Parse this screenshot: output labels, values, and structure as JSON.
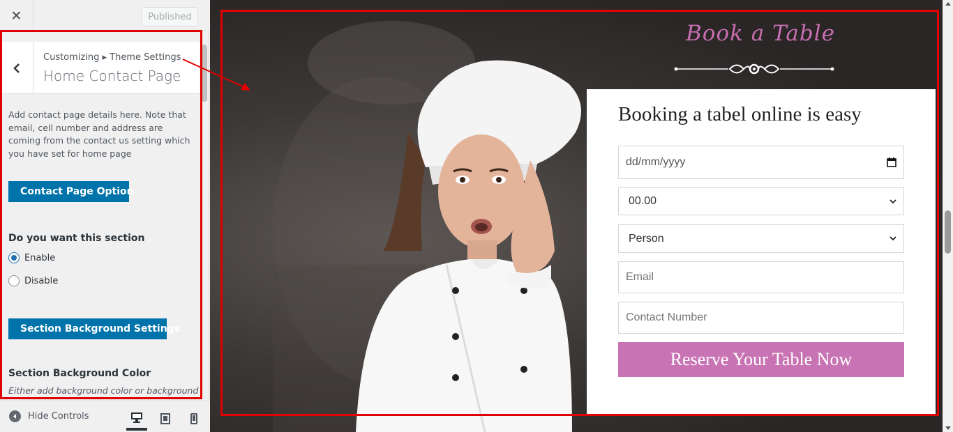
{
  "topbar": {
    "close_icon": "close-icon",
    "publish_label": "Published"
  },
  "section": {
    "breadcrumb": "Customizing ▸ Theme Settings",
    "title": "Home Contact Page",
    "description": "Add contact page details here. Note that email, cell number and address are coming from the contact us setting which you have set for home page",
    "contact_option_label": "Contact Page Option",
    "enable_question": "Do you want this section",
    "radio_enable": "Enable",
    "radio_disable": "Disable",
    "radio_selected": "Enable",
    "bg_settings_label": "Section Background Settings",
    "bg_color_label": "Section Background Color",
    "bg_color_desc": "Either add background color or background"
  },
  "footer": {
    "hide_controls_label": "Hide Controls",
    "devices": [
      "desktop-icon",
      "tablet-icon",
      "mobile-icon"
    ],
    "active_device": "desktop"
  },
  "preview": {
    "book_title": "Book a Table",
    "form_heading": "Booking a tabel online is easy",
    "date_placeholder": "dd/mm/yyyy",
    "time_value": "00.00",
    "person_value": "Person",
    "email_placeholder": "Email",
    "contact_placeholder": "Contact Number",
    "reserve_label": "Reserve Your Table Now"
  },
  "colors": {
    "highlight": "#e00000",
    "wp_button": "#0073aa",
    "accent_pink": "#c873b3"
  }
}
